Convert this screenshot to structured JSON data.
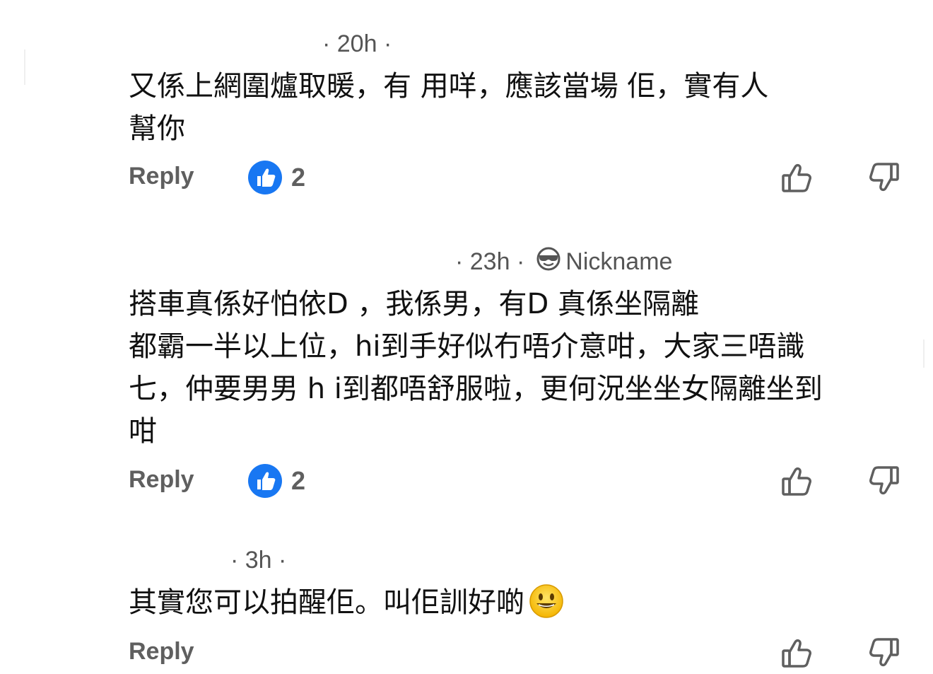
{
  "comments": [
    {
      "meta": "· 20h ·",
      "lines": [
        "又係上網圍爐取暖，有 用咩，應該當場 佢，實有人",
        "幫你"
      ],
      "reply_label": "Reply",
      "like_count": "2"
    },
    {
      "meta": "· 23h ·",
      "nickname": "Nickname",
      "lines": [
        "搭車真係好怕依D ，我係男，有D 真係坐隔離",
        "都霸一半以上位，hi到手好似冇唔介意咁，大家三唔識",
        "七，仲要男男 h i到都唔舒服啦，更何況坐坐女隔離坐到",
        "咁"
      ],
      "reply_label": "Reply",
      "like_count": "2"
    },
    {
      "meta": "· 3h ·",
      "lines": [
        "其實您可以拍醒佢。叫佢訓好啲"
      ],
      "reply_label": "Reply"
    }
  ],
  "icons": {
    "like_badge": "blue-thumbs-up-badge",
    "thumb_up": "thumbs-up-outline-icon",
    "thumb_down": "thumbs-down-outline-icon",
    "nickname": "sunglasses-face-icon",
    "emoji": "smiley-emoji"
  },
  "colors": {
    "like_blue": "#1877f2",
    "meta_gray": "#555555",
    "reply_gray": "#5f5f5f"
  }
}
